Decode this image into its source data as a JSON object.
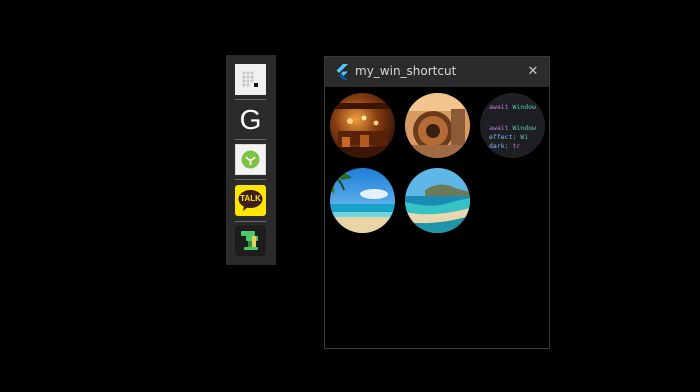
{
  "shortcut_bar": {
    "items": [
      {
        "name": "dots-app",
        "icon": "dots-grid-icon"
      },
      {
        "name": "g-app",
        "icon": "letter-g-icon",
        "glyph": "G"
      },
      {
        "name": "green-app",
        "icon": "green-circle-icon"
      },
      {
        "name": "kakaotalk",
        "icon": "kakaotalk-icon",
        "label": "TALK"
      },
      {
        "name": "green-tool-app",
        "icon": "green-tool-icon"
      }
    ]
  },
  "window": {
    "title": "my_win_shortcut",
    "close_glyph": "✕",
    "colors": {
      "titlebar": "#2b2b2b",
      "border": "#3a3a3a",
      "accent": "#54c5f8"
    },
    "thumbnails": [
      {
        "name": "restaurant-photo"
      },
      {
        "name": "machinery-photo"
      },
      {
        "name": "code-snippet",
        "code_lines": [
          {
            "parts": [
              {
                "t": "await ",
                "c": "kw"
              },
              {
                "t": "Window",
                "c": "ty"
              }
            ]
          },
          {
            "parts": [
              {
                "t": "",
                "c": ""
              }
            ]
          },
          {
            "parts": [
              {
                "t": "await ",
                "c": "kw"
              },
              {
                "t": "Window",
                "c": "ty"
              }
            ]
          },
          {
            "parts": [
              {
                "t": "  effect: ",
                "c": "pr"
              },
              {
                "t": "Wi",
                "c": "ty"
              }
            ]
          },
          {
            "parts": [
              {
                "t": "  dark: ",
                "c": "pr"
              },
              {
                "t": "tr",
                "c": "kw"
              }
            ]
          }
        ]
      },
      {
        "name": "beach-palm-photo"
      },
      {
        "name": "coastline-photo"
      }
    ]
  }
}
